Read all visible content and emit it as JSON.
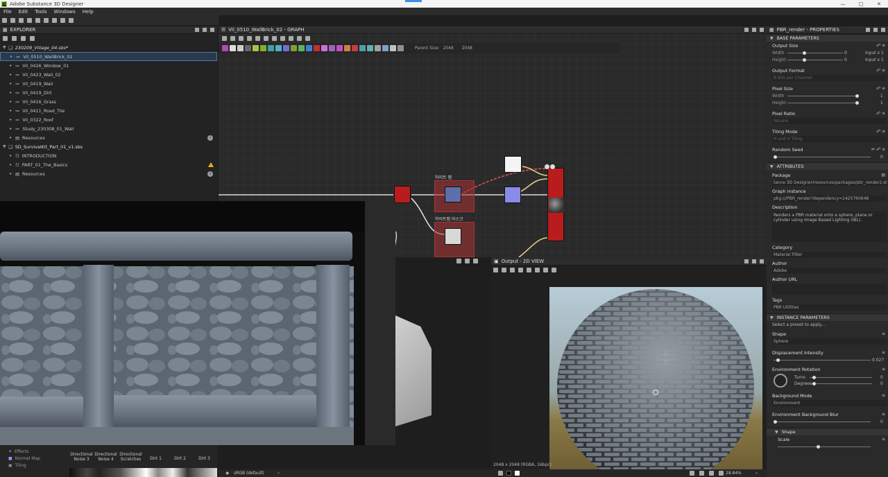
{
  "app": {
    "title": "Adobe Substance 3D Designer",
    "logo": "Ds"
  },
  "menu": [
    "File",
    "Edit",
    "Tools",
    "Windows",
    "Help"
  ],
  "explorer": {
    "title": "EXPLORER",
    "packages": [
      {
        "name": "230209_Village_04.sbs*",
        "items": [
          {
            "label": "Vil_0510_WallBrick_02",
            "selected": true
          },
          {
            "label": "Vil_0426_Window_01"
          },
          {
            "label": "Vil_0423_Wall_02"
          },
          {
            "label": "Vil_0419_Wall"
          },
          {
            "label": "Vil_0419_Dirt"
          },
          {
            "label": "Vil_0416_Grass"
          },
          {
            "label": "Vil_0411_Road_Tile"
          },
          {
            "label": "Vil_0322_Roof"
          },
          {
            "label": "Study_230308_01_Wall"
          },
          {
            "label": "Resources"
          }
        ]
      },
      {
        "name": "SD_SurvivalKit_Part_01_v1.sbs",
        "items": [
          {
            "label": "INTRODUCTION"
          },
          {
            "label": "PART_01_The_Basics"
          },
          {
            "label": "Resources"
          }
        ]
      }
    ]
  },
  "graph": {
    "title": "Vil_0510_WallBrick_02 - GRAPH",
    "parent_size_label": "Parent Size:",
    "parent_size": "2048",
    "size": "2048",
    "frames": [
      {
        "label": "하이트 맵"
      },
      {
        "label": "하이트맵 마스크"
      }
    ]
  },
  "view2d": {
    "title": "Output - 2D VIEW",
    "status": "2048 x 2048 (RGBA, 16bpc)",
    "zoom": "28.84%"
  },
  "colorspace": "sRGB (default)",
  "bottom_list": [
    "Effects",
    "Normal Map",
    "Tiling"
  ],
  "thumbnails": [
    "Directional Noise 3",
    "Directional Noise 4",
    "Directional Scratches",
    "Dirt 1",
    "Dirt 2",
    "Dirt 3"
  ],
  "properties": {
    "title": "PBR_render - PROPERTIES",
    "base_section": "BASE PARAMETERS",
    "output_size": {
      "label": "Output Size",
      "width_label": "Width",
      "height_label": "Height",
      "width": "0",
      "height": "0",
      "width_mode": "Input x 1",
      "height_mode": "Input x 1"
    },
    "output_format": {
      "label": "Output Format",
      "value": "8 Bits per Channel"
    },
    "pixel_size": {
      "label": "Pixel Size",
      "width_label": "Width",
      "height_label": "Height",
      "width": "1",
      "height": "1"
    },
    "pixel_ratio": {
      "label": "Pixel Ratio",
      "value": "Square"
    },
    "tiling_mode": {
      "label": "Tiling Mode",
      "value": "H and V Tiling"
    },
    "random_seed": {
      "label": "Random Seed",
      "value": "0"
    },
    "attributes_section": "ATTRIBUTES",
    "package": {
      "label": "Package",
      "value": "tance 3D Designer/resources/packages/pbr_render2.sbs"
    },
    "graph_instance": {
      "label": "Graph instance",
      "value": "pkg:///PBR_render?dependency=1425760648"
    },
    "description": {
      "label": "Description",
      "value": "Renders a PBR material onto a sphere, plane or cylinder using Image Based Lighting (IBL)."
    },
    "category": {
      "label": "Category",
      "value": "Material Filter"
    },
    "author": {
      "label": "Author",
      "value": "Adobe"
    },
    "author_url": {
      "label": "Author URL",
      "value": ""
    },
    "tags": {
      "label": "Tags",
      "value": "PBR Utilities"
    },
    "instance_section": "INSTANCE PARAMETERS",
    "preset": "Select a preset to apply...",
    "shape": {
      "label": "Shape",
      "value": "Sphere"
    },
    "displacement": {
      "label": "Displacement Intensity",
      "value": "0.027",
      "fraction": 0.027
    },
    "env_rotation": {
      "label": "Environment Rotation",
      "turns_label": "Turns",
      "degrees_label": "Degrees",
      "turns": "0",
      "degrees": "0"
    },
    "bg_mode": {
      "label": "Background Mode",
      "value": "Environment"
    },
    "bg_blur": {
      "label": "Environment Background Blur",
      "value": "0"
    },
    "shape_section": "Shape",
    "scale": {
      "label": "Scale"
    }
  }
}
